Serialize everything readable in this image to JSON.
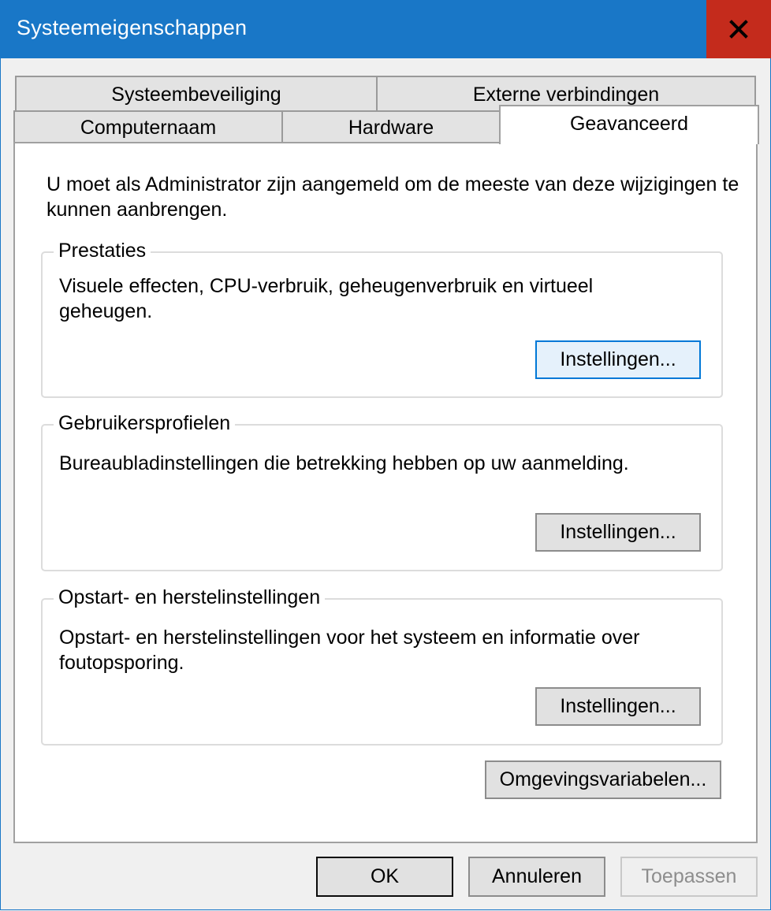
{
  "window": {
    "title": "Systeemeigenschappen",
    "close_icon": "close-icon",
    "accent_color": "#1977c7",
    "close_color": "#c42b1c"
  },
  "tabs": {
    "back_row": [
      {
        "label": "Systeembeveiliging"
      },
      {
        "label": "Externe verbindingen"
      }
    ],
    "front_row": [
      {
        "label": "Computernaam"
      },
      {
        "label": "Hardware"
      },
      {
        "label": "Geavanceerd",
        "selected": true
      }
    ]
  },
  "panel": {
    "intro": "U moet als Administrator zijn aangemeld om de meeste van deze wijzigingen te kunnen aanbrengen.",
    "groups": [
      {
        "title": "Prestaties",
        "description": "Visuele effecten, CPU-verbruik, geheugenverbruik en virtueel geheugen.",
        "button": "Instellingen..."
      },
      {
        "title": "Gebruikersprofielen",
        "description": "Bureaubladinstellingen die betrekking hebben op uw aanmelding.",
        "button": "Instellingen..."
      },
      {
        "title": "Opstart- en herstelinstellingen",
        "description": "Opstart- en herstelinstellingen voor het systeem en informatie over foutopsporing.",
        "button": "Instellingen..."
      }
    ],
    "env_button": "Omgevingsvariabelen..."
  },
  "footer": {
    "ok": "OK",
    "cancel": "Annuleren",
    "apply": "Toepassen"
  }
}
